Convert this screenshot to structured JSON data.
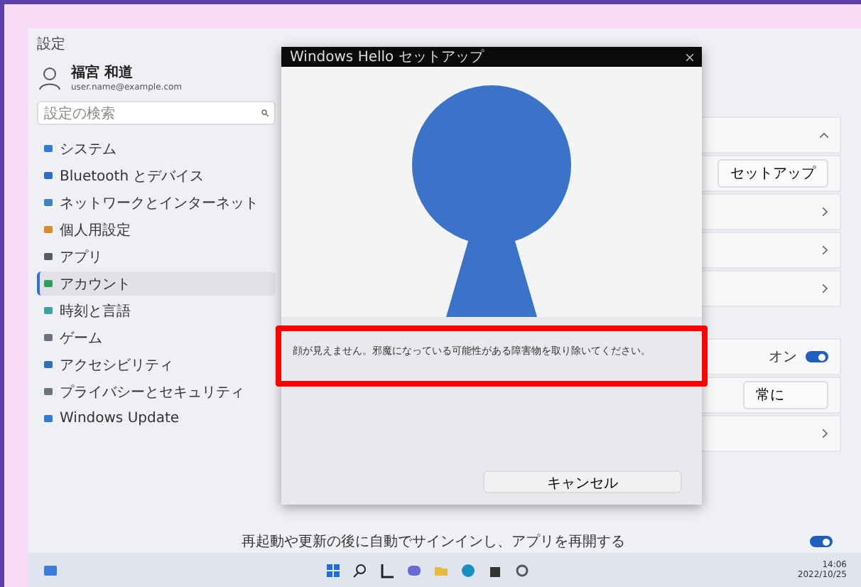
{
  "settings": {
    "title": "設定",
    "user": {
      "name": "福宮 和道",
      "email": "user.name@example.com"
    },
    "search": {
      "placeholder": "設定の検索"
    },
    "nav": [
      {
        "label": "システム",
        "selected": false,
        "color": "#2f7bd6"
      },
      {
        "label": "Bluetooth とデバイス",
        "selected": false,
        "color": "#2a6fc4"
      },
      {
        "label": "ネットワークとインターネット",
        "selected": false,
        "color": "#3b82c9"
      },
      {
        "label": "個人用設定",
        "selected": false,
        "color": "#d98a2b"
      },
      {
        "label": "アプリ",
        "selected": false,
        "color": "#555b66"
      },
      {
        "label": "アカウント",
        "selected": true,
        "color": "#2e9e5b"
      },
      {
        "label": "時刻と言語",
        "selected": false,
        "color": "#3aa3a0"
      },
      {
        "label": "ゲーム",
        "selected": false,
        "color": "#6b7280"
      },
      {
        "label": "アクセシビリティ",
        "selected": false,
        "color": "#2f6fb5"
      },
      {
        "label": "プライバシーとセキュリティ",
        "selected": false,
        "color": "#6b7280"
      },
      {
        "label": "Windows Update",
        "selected": false,
        "color": "#2f7bd6"
      }
    ],
    "rows": [
      {
        "kind": "expander",
        "expanded": true
      },
      {
        "kind": "button",
        "label": "セットアップ"
      },
      {
        "kind": "chevron"
      },
      {
        "kind": "chevron"
      },
      {
        "kind": "chevron"
      },
      {
        "kind": "gap"
      },
      {
        "kind": "toggle",
        "label": "オン",
        "on": true
      },
      {
        "kind": "select",
        "label": "常に"
      },
      {
        "kind": "chevron"
      }
    ],
    "footer": "再起動や更新の後に自動でサインインし、アプリを再開する",
    "footer_toggle": {
      "on": true
    }
  },
  "dialog": {
    "title": "Windows Hello セットアップ",
    "message": "顔が見えません。邪魔になっている可能性がある障害物を取り除いてください。",
    "highlighted": true,
    "button": "キャンセル"
  },
  "taskbar": {
    "clock": "14:06",
    "date": "2022/10/25"
  }
}
